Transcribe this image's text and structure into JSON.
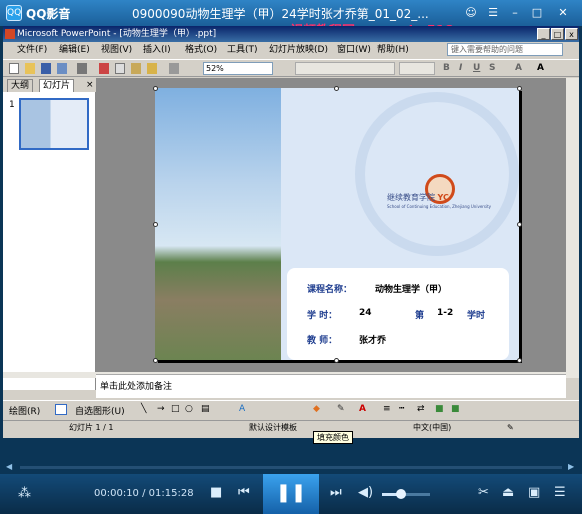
{
  "player": {
    "app_name": "QQ影音",
    "logo": "QQ",
    "document_title": "0900090动物生理学（甲）24学时张才乔第_01_02_...",
    "watermark": "视频教程网www.mba518.com",
    "time_current": "00:00:10",
    "time_separator": " / ",
    "time_total": "01:15:28",
    "volume_level": 0.4
  },
  "ppt": {
    "window_title": "Microsoft PowerPoint - [动物生理学（甲）.ppt]",
    "menu": [
      "文件(F)",
      "编辑(E)",
      "视图(V)",
      "插入(I)",
      "格式(O)",
      "工具(T)",
      "幻灯片放映(D)",
      "窗口(W)",
      "帮助(H)"
    ],
    "help_placeholder": "键入需要帮助的问题",
    "zoom": "52%",
    "tabs": [
      "大纲",
      "幻灯片"
    ],
    "slide_number": "1",
    "notes_placeholder": "单击此处添加备注",
    "draw_label": "绘图(R)",
    "autoshapes_label": "自选图形(U)",
    "tooltip": "填充颜色",
    "status": {
      "slide": "幻灯片 1 / 1",
      "template": "默认设计模板",
      "language": "中文(中国)"
    }
  },
  "slide": {
    "school_name": "继续教育学院",
    "school_tag": "YC",
    "school_english": "School of Continuing Education, Zhejiang University",
    "course_label": "课程名称：",
    "course_value": "动物生理学（甲）",
    "hours_label": "学  时：",
    "hours_value": "24",
    "section_label": "第",
    "section_value": "1-2",
    "section_unit": "学时",
    "teacher_label": "教  师：",
    "teacher_value": "张才乔"
  },
  "colors": {
    "player_bar": "#1b5f99",
    "accent_blue": "#1e3d8f",
    "watermark": "#ff2f6a"
  }
}
